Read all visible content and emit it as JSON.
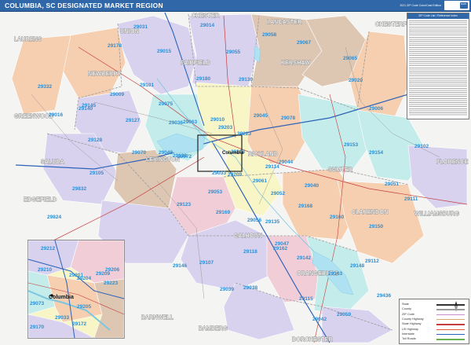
{
  "header": {
    "title": "COLUMBIA, SC DESIGNATED MARKET REGION",
    "edition": "2021 ZIP Code Color/Cast Edition",
    "brand_mark": "MAPS"
  },
  "colors": {
    "title_bar": "#2f67a8",
    "zip_label": "#2b8fd6",
    "region_tan": "#ddc7b3",
    "region_orange": "#f6ceb0",
    "region_lavender": "#d8d2ef",
    "region_yellow": "#f8f5c6",
    "region_teal": "#c3ecea",
    "region_pink": "#f1cdd8",
    "background": "#f4f4f2",
    "interstate": "#2d62b8",
    "highway": "#c63b3b",
    "water": "#aee1f2"
  },
  "counties": [
    {
      "name": "CHESTER"
    },
    {
      "name": "UNION"
    },
    {
      "name": "LANCASTER"
    },
    {
      "name": "CHESTERFIELD"
    },
    {
      "name": "LAURENS"
    },
    {
      "name": "FAIRFIELD"
    },
    {
      "name": "NEWBERRY"
    },
    {
      "name": "KERSHAW"
    },
    {
      "name": "GREENWOOD"
    },
    {
      "name": "SALUDA"
    },
    {
      "name": "LEXINGTON"
    },
    {
      "name": "RICHLAND"
    },
    {
      "name": "SUMTER"
    },
    {
      "name": "FLORENCE"
    },
    {
      "name": "EDGEFIELD"
    },
    {
      "name": "CALHOUN"
    },
    {
      "name": "CLARENDON"
    },
    {
      "name": "WILLIAMSBURG"
    },
    {
      "name": "AIKEN"
    },
    {
      "name": "ORANGEBURG"
    },
    {
      "name": "BARNWELL"
    },
    {
      "name": "BAMBERG"
    },
    {
      "name": "DORCHESTER"
    }
  ],
  "zip_labels": [
    "29014",
    "29031",
    "29058",
    "29067",
    "29178",
    "29015",
    "29055",
    "29065",
    "29130",
    "29020",
    "29332",
    "29180",
    "29045",
    "29078",
    "29101",
    "29009",
    "29145",
    "29140",
    "29075",
    "29063",
    "29036",
    "29203",
    "29223",
    "29016",
    "29010",
    "29128",
    "29127",
    "29006",
    "29070",
    "29204",
    "29044",
    "29153",
    "29154",
    "29102",
    "29048",
    "29138",
    "29072",
    "29033",
    "29209",
    "29061",
    "29040",
    "29051",
    "29114",
    "29832",
    "29053",
    "29169",
    "29052",
    "29105",
    "29123",
    "29168",
    "29150",
    "29111",
    "29056",
    "29824",
    "29160",
    "29135",
    "29162",
    "29112",
    "29118",
    "29142",
    "29107",
    "29146",
    "29047",
    "29039",
    "29163",
    "29038",
    "29115",
    "29436",
    "29042",
    "29059",
    "29148"
  ],
  "inset": {
    "city": "Columbia",
    "zips": [
      "29212",
      "29210",
      "29201",
      "29204",
      "29206",
      "29209",
      "29223",
      "29205",
      "29033",
      "29073",
      "29170",
      "29172"
    ]
  },
  "legend": {
    "items": [
      {
        "label": "State",
        "color": "#333333"
      },
      {
        "label": "County",
        "color": "#9a9a9a"
      },
      {
        "label": "ZIP Code",
        "color": "#c88fd0"
      },
      {
        "label": "County Highway",
        "color": "#d9a66b"
      },
      {
        "label": "State Highway",
        "color": "#c63b3b"
      },
      {
        "label": "US Highway",
        "color": "#e05c2f"
      },
      {
        "label": "Interstate",
        "color": "#2d62b8"
      },
      {
        "label": "Toll Roads",
        "color": "#6ab04c"
      }
    ]
  },
  "zip_index": {
    "title": "ZIP Code List / Reference Index"
  }
}
